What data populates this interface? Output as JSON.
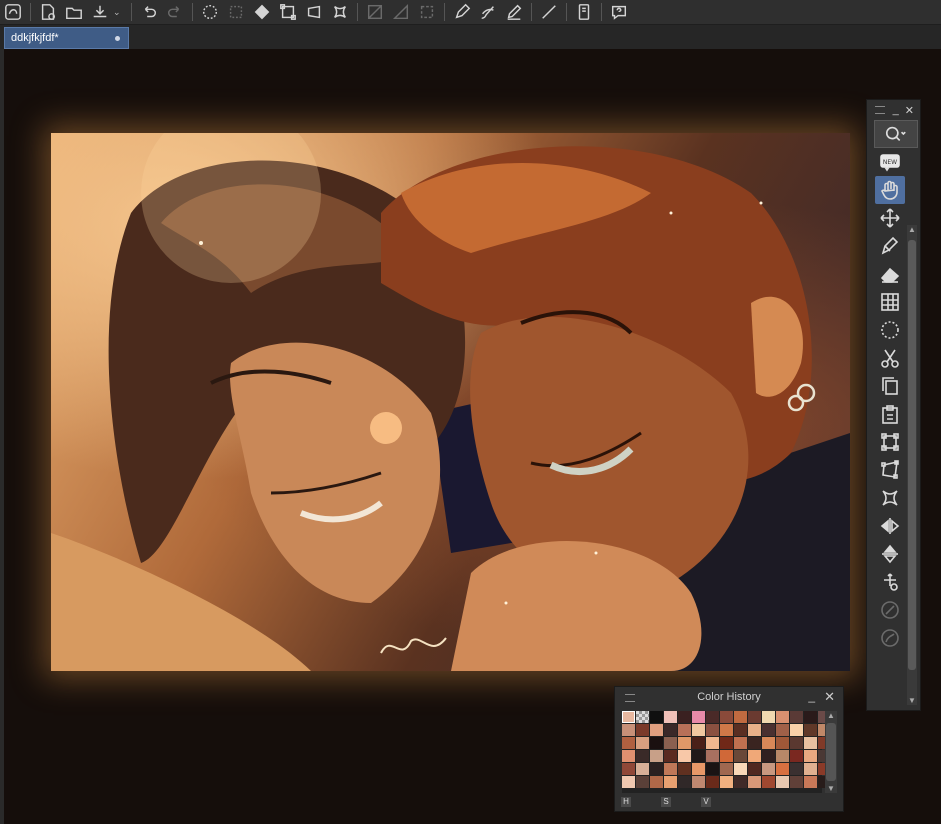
{
  "app": {
    "document_tab": "ddkjfkjfdf*"
  },
  "toolbar": {
    "icons": [
      "app-logo-icon",
      "new-file-icon",
      "open-folder-icon",
      "save-icon",
      "undo-icon",
      "redo-icon",
      "select-all-icon",
      "deselect-icon",
      "fill-icon",
      "transform-icon",
      "scale-icon",
      "mesh-icon",
      "grid-icon",
      "ruler-icon",
      "frame-icon",
      "edit-icon",
      "pen-icon",
      "line-icon",
      "tablet-icon",
      "help-icon"
    ]
  },
  "tool_palette": {
    "tools": [
      "hand-icon",
      "move-icon",
      "pen-icon",
      "eraser-icon",
      "grid-icon",
      "lasso-icon",
      "scissors-icon",
      "copy-icon",
      "paste-icon",
      "transform-icon",
      "distort-icon",
      "mesh-icon",
      "flip-horizontal-icon",
      "flip-vertical-icon",
      "anchor-icon",
      "fill-disabled-icon",
      "blend-disabled-icon"
    ],
    "active_tool": "hand-icon",
    "new_badge": "NEW"
  },
  "color_history": {
    "title": "Color History",
    "footer_buttons": [
      "H",
      "S",
      "V"
    ],
    "swatches": [
      "#e8b8a0",
      "#checker",
      "#101010",
      "#f0c0b8",
      "#3a2020",
      "#e88aa8",
      "#4a2a28",
      "#8a4a3a",
      "#c06a40",
      "#6a3a30",
      "#f0d8b0",
      "#d89070",
      "#5a3a36",
      "#2a1a1a",
      "#6a4a48",
      "#c89078",
      "#7a3a2a",
      "#e0a080",
      "#3a2828",
      "#b87058",
      "#f0c8a0",
      "#8a5040",
      "#d07848",
      "#5a2e22",
      "#e8b088",
      "#4a3030",
      "#a06048",
      "#f8d0a8",
      "#603828",
      "#c08868",
      "#b06040",
      "#d8a080",
      "#1a1010",
      "#8a6050",
      "#e09868",
      "#4a2018",
      "#f0b890",
      "#702818",
      "#c07050",
      "#3a2420",
      "#d88858",
      "#a05838",
      "#5a3830",
      "#e8c0a0",
      "#803a28",
      "#e09070",
      "#3a2a28",
      "#c8a088",
      "#5a2a20",
      "#f8c8a8",
      "#201818",
      "#a87060",
      "#d06838",
      "#6a4838",
      "#f0a878",
      "#302020",
      "#b88868",
      "#7a2820",
      "#e8a880",
      "#4a3834",
      "#904838",
      "#d8b098",
      "#2a2020",
      "#c07858",
      "#603020",
      "#e89868",
      "#1a1414",
      "#a06850",
      "#f8d8b8",
      "#502820",
      "#c89880",
      "#d87040",
      "#3a3030",
      "#e0b090",
      "#8a3a28",
      "#f0c8b0",
      "#5a4038",
      "#b06848",
      "#e8a070",
      "#302828",
      "#c08870",
      "#6a2a1a",
      "#f0b080",
      "#402a28",
      "#d89878",
      "#a04830",
      "#e8c8b0",
      "#604038",
      "#c87858",
      "#281c1a"
    ]
  }
}
